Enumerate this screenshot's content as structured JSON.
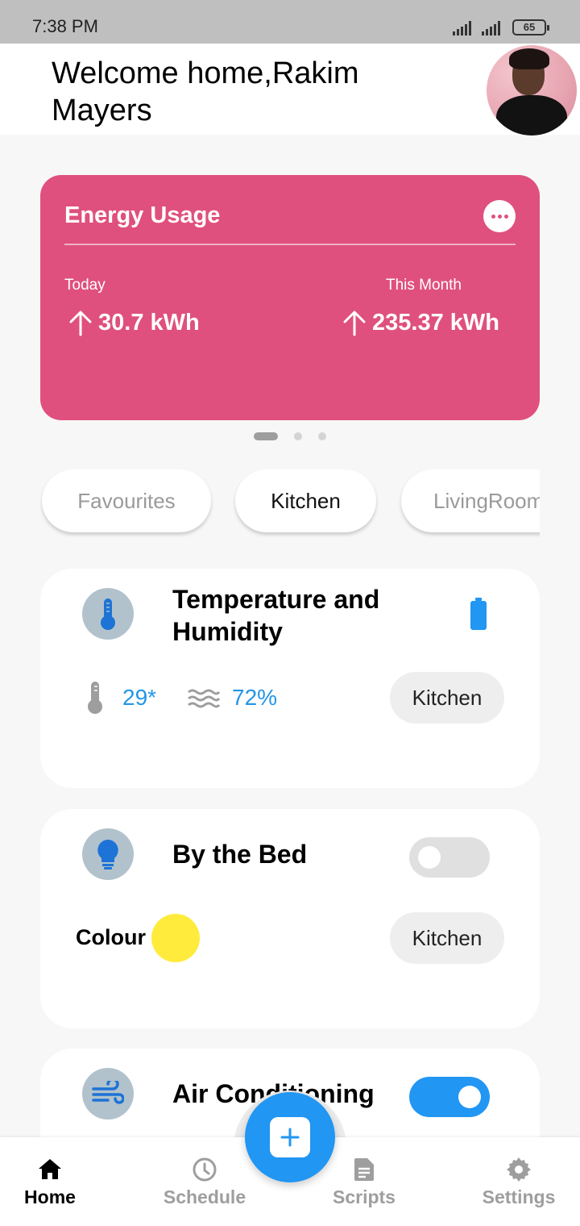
{
  "status_bar": {
    "time": "7:38 PM",
    "battery": "65"
  },
  "header": {
    "welcome": "Welcome home,Rakim Mayers"
  },
  "energy": {
    "title": "Energy Usage",
    "today_label": "Today",
    "today_value": "30.7 kWh",
    "month_label": "This Month",
    "month_value": "235.37 kWh",
    "color": "#e0507e"
  },
  "rooms": [
    "Favourites",
    "Kitchen",
    "LivingRoom"
  ],
  "devices": {
    "temp": {
      "title": "Temperature and Humidity",
      "temperature": "29*",
      "humidity": "72%",
      "room": "Kitchen"
    },
    "bed": {
      "title": "By the Bed",
      "colour_label": "Colour",
      "room": "Kitchen",
      "toggle_on": false,
      "colour": "#ffeb3b"
    },
    "ac": {
      "title": "Air Conditioning",
      "toggle_on": true
    }
  },
  "nav": {
    "home": "Home",
    "schedule": "Schedule",
    "scripts": "Scripts",
    "settings": "Settings"
  },
  "icons": {
    "temp": "thermometer-icon",
    "battery": "battery-icon",
    "bed": "lightbulb-icon",
    "ac": "wind-icon",
    "fab": "add-icon"
  },
  "accent": "#2196f3"
}
